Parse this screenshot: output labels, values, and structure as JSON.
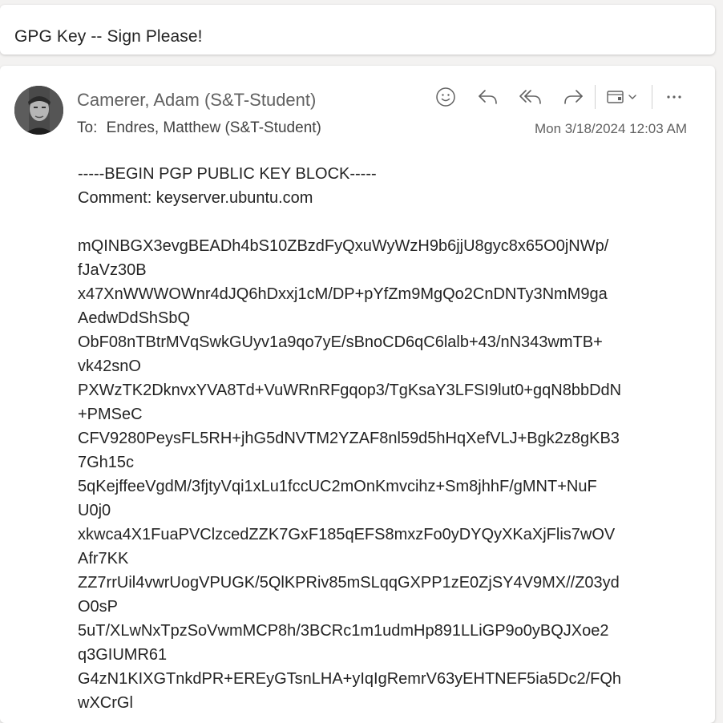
{
  "subject": "GPG Key -- Sign Please!",
  "message": {
    "sender": "Camerer, Adam (S&T-Student)",
    "to_label": "To:",
    "to": "Endres, Matthew (S&T-Student)",
    "date": "Mon 3/18/2024 12:03 AM",
    "toolbar": {
      "icons": [
        "smiley-icon",
        "reply-icon",
        "reply-all-icon",
        "forward-icon",
        "apps-icon",
        "more-icon"
      ]
    },
    "body": {
      "header": "-----BEGIN PGP PUBLIC KEY BLOCK-----",
      "comment": "Comment: keyserver.ubuntu.com",
      "key_lines": [
        "mQINBGX3evgBEADh4bS10ZBzdFyQxuWyWzH9b6jjU8gyc8x65O0jNWp/",
        "fJaVz30B",
        "x47XnWWWOWnr4dJQ6hDxxj1cM/DP+pYfZm9MgQo2CnDNTy3NmM9ga",
        "AedwDdShSbQ",
        "ObF08nTBtrMVqSwkGUyv1a9qo7yE/sBnoCD6qC6lalb+43/nN343wmTB+",
        "vk42snO",
        "PXWzTK2DknvxYVA8Td+VuWRnRFgqop3/TgKsaY3LFSI9lut0+gqN8bbDdN",
        "+PMSeC",
        "CFV9280PeysFL5RH+jhG5dNVTM2YZAF8nl59d5hHqXefVLJ+Bgk2z8gKB3",
        "7Gh15c",
        "5qKejffeeVgdM/3fjtyVqi1xLu1fccUC2mOnKmvcihz+Sm8jhhF/gMNT+NuF",
        "U0j0",
        "xkwca4X1FuaPVClzcedZZK7GxF185qEFS8mxzFo0yDYQyXKaXjFlis7wOV",
        "Afr7KK",
        "ZZ7rrUil4vwrUogVPUGK/5QlKPRiv85mSLqqGXPP1zE0ZjSY4V9MX//Z03yd",
        "O0sP",
        "5uT/XLwNxTpzSoVwmMCP8h/3BCRc1m1udmHp891LLiGP9o0yBQJXoe2",
        "q3GIUMR61",
        "G4zN1KIXGTnkdPR+EREyGTsnLHA+yIqIgRemrV63yEHTNEF5ia5Dc2/FQh",
        "wXCrGl"
      ]
    }
  }
}
